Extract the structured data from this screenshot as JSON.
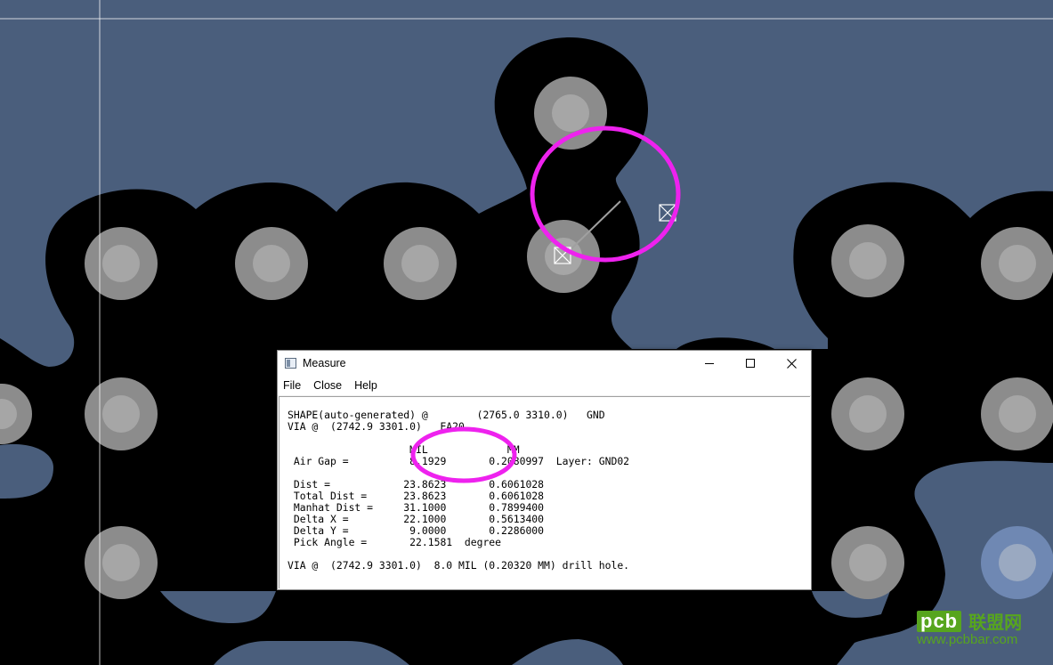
{
  "colors": {
    "board": "#4a5e7c",
    "copper_shape": "#000000",
    "via_outer": "#8c8c8c",
    "via_inner": "#a6a6a6",
    "via_blue_outer": "#6f88b3",
    "via_blue_inner": "#9aa9c1",
    "highlight": "#ee22ee",
    "measure_line": "#a0a0a0",
    "watermark": "#57a51e"
  },
  "window": {
    "title": "Measure",
    "icon": "app-window-icon",
    "controls": [
      "minimize-icon",
      "maximize-icon",
      "close-icon"
    ]
  },
  "menu": {
    "items": [
      "File",
      "Close",
      "Help"
    ]
  },
  "report": {
    "lines": [
      "SHAPE(auto-generated) @        (2765.0 3310.0)   GND",
      "VIA @  (2742.9 3301.0)   EA20",
      "                    MIL             MM",
      " Air Gap =          8.1929       0.2080997  Layer: GND02",
      " Dist =            23.8623       0.6061028",
      " Total Dist =      23.8623       0.6061028",
      " Manhat Dist =     31.1000       0.7899400",
      " Delta X =         22.1000       0.5613400",
      " Delta Y =          9.0000       0.2286000",
      " Pick Angle =       22.1581  degree",
      "VIA @  (2742.9 3301.0)  8.0 MIL (0.20320 MM) drill hole."
    ]
  },
  "watermark": {
    "logo": "pcb",
    "name": "联盟网",
    "url": "www.pcbbar.com"
  }
}
